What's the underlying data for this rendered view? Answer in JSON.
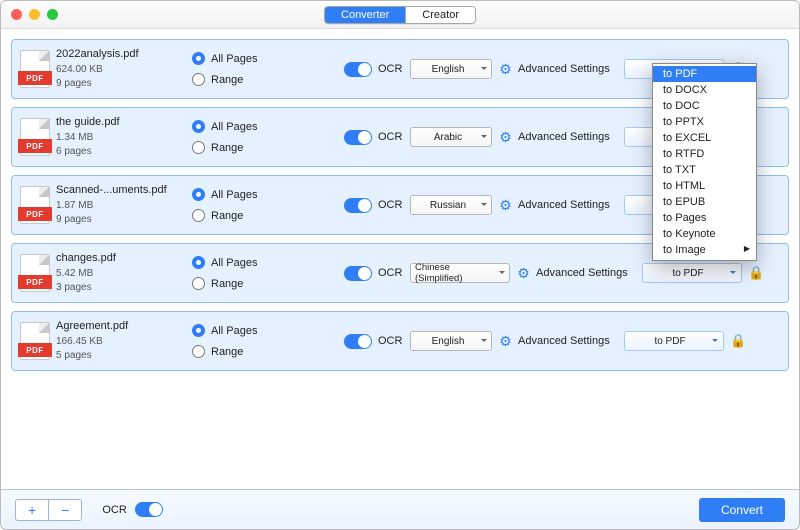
{
  "tabs": {
    "converter": "Converter",
    "creator": "Creator"
  },
  "labels": {
    "all_pages": "All Pages",
    "range": "Range",
    "ocr": "OCR",
    "advanced": "Advanced Settings",
    "footer_ocr": "OCR",
    "convert": "Convert",
    "plus": "+",
    "minus": "−"
  },
  "files": [
    {
      "name": "2022analysis.pdf",
      "size": "624.00 KB",
      "pages": "9 pages",
      "lang": "English",
      "fmt": "to PDF"
    },
    {
      "name": "the guide.pdf",
      "size": "1.34 MB",
      "pages": "6 pages",
      "lang": "Arabic",
      "fmt": "to PDF"
    },
    {
      "name": "Scanned-...uments.pdf",
      "size": "1.87 MB",
      "pages": "9 pages",
      "lang": "Russian",
      "fmt": "to PDF"
    },
    {
      "name": "changes.pdf",
      "size": "5.42 MB",
      "pages": "3 pages",
      "lang": "Chinese (Simplified)",
      "fmt": "to PDF"
    },
    {
      "name": "Agreement.pdf",
      "size": "166.45 KB",
      "pages": "5 pages",
      "lang": "English",
      "fmt": "to PDF"
    }
  ],
  "dropdown": {
    "open_row": 0,
    "items": [
      "to PDF",
      "to DOCX",
      "to DOC",
      "to PPTX",
      "to EXCEL",
      "to RTFD",
      "to TXT",
      "to HTML",
      "to EPUB",
      "to Pages",
      "to Keynote",
      "to Image"
    ],
    "selected": "to PDF",
    "submenu": "to Image"
  }
}
